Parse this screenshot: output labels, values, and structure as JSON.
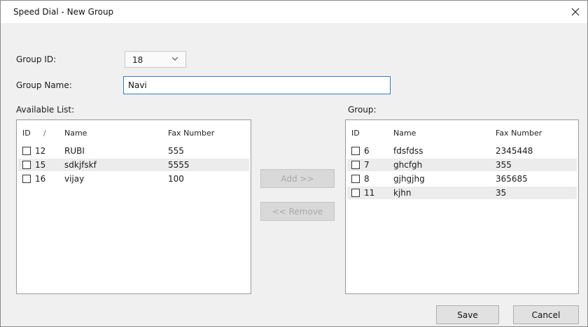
{
  "window": {
    "title": "Speed Dial - New Group"
  },
  "form": {
    "group_id_label": "Group ID:",
    "group_id_value": "18",
    "group_name_label": "Group Name:",
    "group_name_value": "Navi"
  },
  "available": {
    "label": "Available List:",
    "headers": {
      "id": "ID",
      "sort": "/",
      "name": "Name",
      "fax": "Fax Number"
    },
    "rows": [
      {
        "id": "12",
        "name": "RUBI",
        "fax": "555"
      },
      {
        "id": "15",
        "name": "sdkjfskf",
        "fax": "5555"
      },
      {
        "id": "16",
        "name": "vijay",
        "fax": "100"
      }
    ]
  },
  "group": {
    "label": "Group:",
    "headers": {
      "id": "ID",
      "name": "Name",
      "fax": "Fax Number"
    },
    "rows": [
      {
        "id": "6",
        "name": "fdsfdss",
        "fax": "2345448"
      },
      {
        "id": "7",
        "name": "ghcfgh",
        "fax": "355"
      },
      {
        "id": "8",
        "name": "gjhgjhg",
        "fax": "365685"
      },
      {
        "id": "11",
        "name": "kjhn",
        "fax": "35"
      }
    ]
  },
  "buttons": {
    "add": "Add >>",
    "remove": "<< Remove",
    "save": "Save",
    "cancel": "Cancel"
  },
  "icons": {
    "close": "close-icon",
    "dropdown": "chevron-down-icon",
    "checkbox": "checkbox"
  }
}
